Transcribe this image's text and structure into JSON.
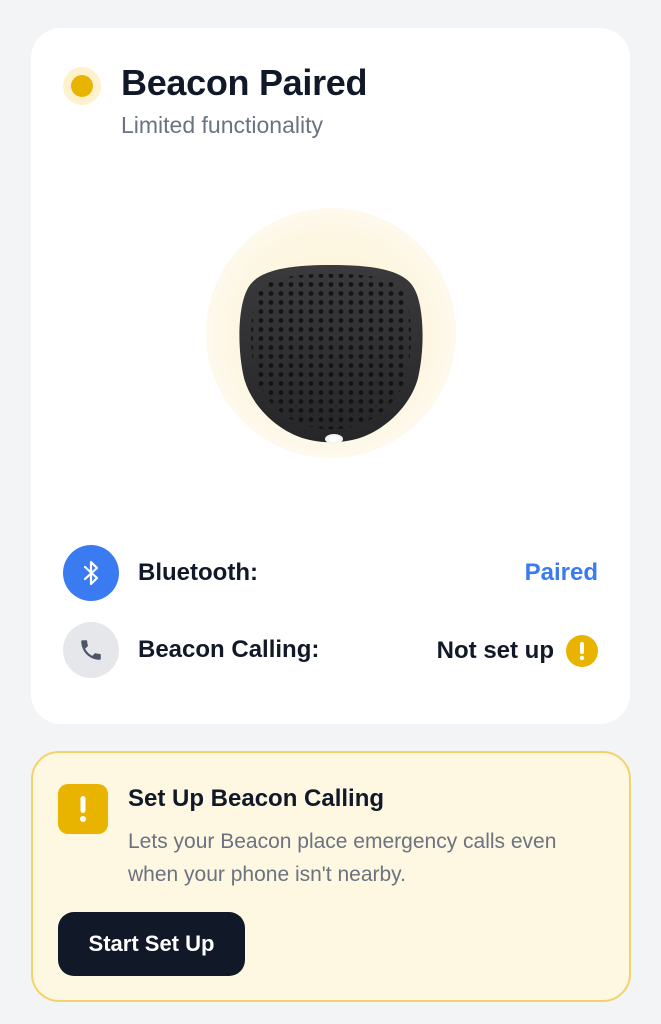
{
  "status": {
    "title": "Beacon Paired",
    "subtitle": "Limited functionality",
    "indicator_color": "#e8b400"
  },
  "device": {
    "icon": "beacon-device-image"
  },
  "connections": [
    {
      "icon": "bluetooth-icon",
      "label": "Bluetooth:",
      "value": "Paired",
      "value_color": "#3b7bf2"
    },
    {
      "icon": "phone-icon",
      "label": "Beacon Calling:",
      "value": "Not set up",
      "warning_icon": "exclamation-icon"
    }
  ],
  "setup_card": {
    "icon": "exclamation-icon",
    "title": "Set Up Beacon Calling",
    "description": "Lets your Beacon place emergency calls even when your phone isn't nearby.",
    "button_label": "Start Set Up",
    "accent_color": "#e8b400",
    "background_color": "#fef8e2"
  }
}
